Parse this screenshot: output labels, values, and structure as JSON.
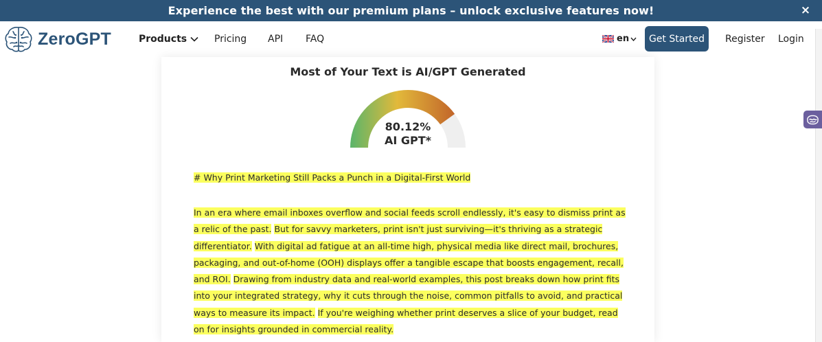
{
  "banner": {
    "text": "Experience the best with our premium plans – unlock exclusive features now!",
    "close_label": "×"
  },
  "nav": {
    "logo_text": "ZeroGPT",
    "items": [
      {
        "label": "Products",
        "has_dropdown": true
      },
      {
        "label": "Pricing"
      },
      {
        "label": "API"
      },
      {
        "label": "FAQ"
      }
    ],
    "language": "en",
    "get_started": "Get Started",
    "register": "Register",
    "login": "Login"
  },
  "result": {
    "title": "Most of Your Text is AI/GPT Generated",
    "percentage_text": "80.12%",
    "percentage_value": 80.12,
    "label": "AI GPT*",
    "heading": "# Why Print Marketing Still Packs a Punch in a Digital-First World",
    "paragraph": [
      {
        "text": "In an era where email inboxes overflow and social feeds scroll endlessly, it's easy to dismiss print as a relic of the past.",
        "highlighted": true
      },
      {
        "text": " ",
        "highlighted": false
      },
      {
        "text": "But for savvy marketers, print isn't just surviving—it's thriving as a strategic differentiator.",
        "highlighted": true
      },
      {
        "text": " ",
        "highlighted": false
      },
      {
        "text": "With digital ad fatigue at an all-time high, physical media like direct mail, brochures, packaging, and out-of-home (OOH) displays offer a tangible escape that boosts engagement, recall, and ROI.",
        "highlighted": true
      },
      {
        "text": " ",
        "highlighted": false
      },
      {
        "text": "Drawing from industry data and real-world examples, this post breaks down how print fits into your integrated strategy, why it cuts through the noise, common pitfalls to avoid, and practical ways to measure its impact.",
        "highlighted": true
      },
      {
        "text": " ",
        "highlighted": false
      },
      {
        "text": "If you're weighing whether print deserves a slice of your budget, read on for insights grounded in commercial reality.",
        "highlighted": true
      }
    ]
  },
  "colors": {
    "brand": "#2c5478",
    "gauge_green": "#5ab56a",
    "gauge_yellow": "#e2b93b",
    "gauge_orange": "#c2652a",
    "gauge_empty": "#efefef",
    "highlight": "#fbff5e",
    "widget": "#6b5f9e"
  },
  "icons": {
    "logo": "brain-icon",
    "close": "close-icon",
    "dropdown": "chevron-down-icon",
    "flag": "uk-flag-icon",
    "side_widget": "brain-widget-icon"
  }
}
